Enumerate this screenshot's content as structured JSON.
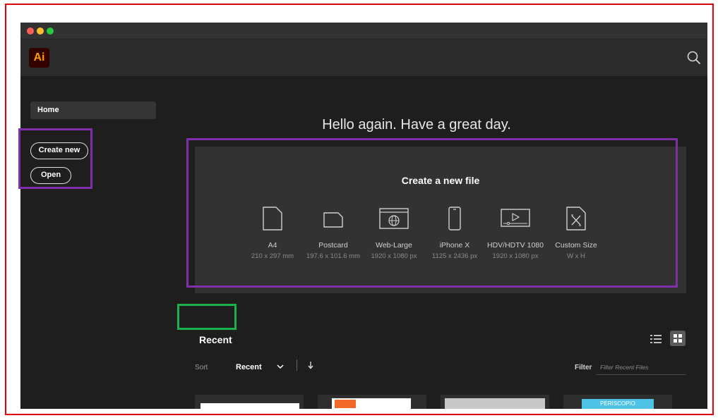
{
  "app": {
    "logo_text": "Ai"
  },
  "sidebar": {
    "home_label": "Home",
    "create_new_label": "Create new",
    "open_label": "Open"
  },
  "main": {
    "greeting": "Hello again. Have a great day.",
    "create_panel": {
      "title": "Create a new file",
      "presets": [
        {
          "name": "A4",
          "size": "210 x 297 mm",
          "icon": "document-portrait-icon"
        },
        {
          "name": "Postcard",
          "size": "197.6 x 101.6 mm",
          "icon": "postcard-icon"
        },
        {
          "name": "Web-Large",
          "size": "1920 x 1080 px",
          "icon": "web-browser-icon"
        },
        {
          "name": "iPhone X",
          "size": "1125 x 2436 px",
          "icon": "phone-icon"
        },
        {
          "name": "HDV/HDTV 1080",
          "size": "1920 x 1080 px",
          "icon": "video-icon"
        },
        {
          "name": "Custom Size",
          "size": "W x H",
          "icon": "custom-size-icon"
        }
      ]
    },
    "recent": {
      "title": "Recent",
      "sort_label": "Sort",
      "sort_value": "Recent",
      "filter_label": "Filter",
      "filter_placeholder": "Filter Recent Files",
      "thumbnails": [
        {
          "label": ""
        },
        {
          "label": ""
        },
        {
          "label": ""
        },
        {
          "label": "PERISCOPIO"
        }
      ]
    }
  },
  "colors": {
    "app_bg": "#1e1e1e",
    "panel_bg": "#323232",
    "logo_bg": "#330000",
    "logo_fg": "#ff9a00",
    "annotation_purple": "#7f2fa8",
    "annotation_green": "#1ab04a",
    "annotation_red": "#e8000b"
  }
}
